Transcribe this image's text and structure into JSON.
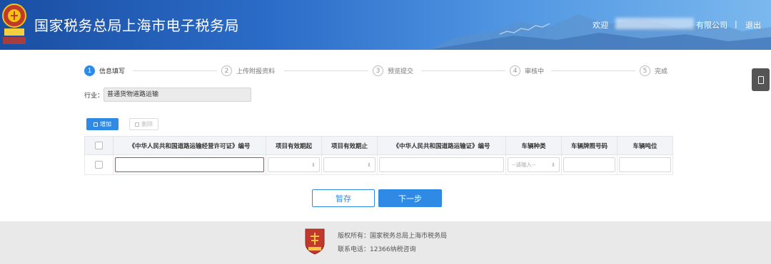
{
  "header": {
    "title": "国家税务总局上海市电子税务局",
    "welcome": "欢迎",
    "company_suffix": "有限公司",
    "separator": "|",
    "logout": "退出",
    "emblem_text": "中国税务"
  },
  "steps": [
    {
      "num": "1",
      "label": "信息填写",
      "active": true
    },
    {
      "num": "2",
      "label": "上传附报资料",
      "active": false
    },
    {
      "num": "3",
      "label": "预览提交",
      "active": false
    },
    {
      "num": "4",
      "label": "审核中",
      "active": false
    },
    {
      "num": "5",
      "label": "完成",
      "active": false
    }
  ],
  "industry": {
    "label": "行业：",
    "value": "普通货物道路运输"
  },
  "toolbar": {
    "add_label": "增加",
    "delete_label": "删除"
  },
  "table": {
    "headers": [
      "《中华人民共和国道路运输经营许可证》编号",
      "项目有效期起",
      "项目有效期止",
      "《中华人民共和国道路运输证》编号",
      "车辆种类",
      "车辆牌照号码",
      "车辆吨位"
    ],
    "row": {
      "vehicle_type_placeholder": "--请输入--",
      "date_arrow": "⇕",
      "select_arrow": "⇕"
    }
  },
  "actions": {
    "save_label": "暂存",
    "next_label": "下一步"
  },
  "footer": {
    "copyright": "版权所有：国家税务总局上海市税务局",
    "phone": "联系电话：12366纳税咨询",
    "logo_text": "税徽"
  },
  "colors": {
    "accent": "#2f8ae5",
    "header_start": "#1a4fa3",
    "header_end": "#7bb8ee",
    "error": "#e03c3c",
    "footer_bg": "#e9e9e9"
  }
}
